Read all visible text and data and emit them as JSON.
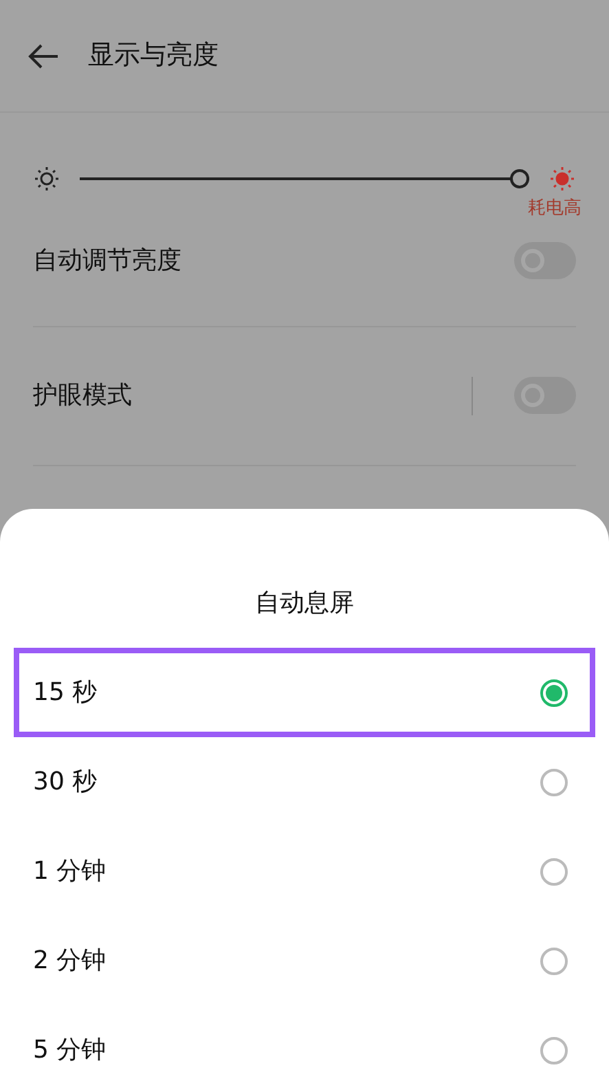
{
  "header": {
    "title": "显示与亮度"
  },
  "brightness": {
    "level": 1,
    "warning": "耗电高"
  },
  "settings": [
    {
      "label": "自动调节亮度",
      "on": false,
      "separator": false
    },
    {
      "label": "护眼模式",
      "on": false,
      "separator": true
    }
  ],
  "sheet": {
    "title": "自动息屏",
    "options": [
      {
        "label": "15 秒",
        "selected": true,
        "highlighted": true
      },
      {
        "label": "30 秒",
        "selected": false,
        "highlighted": false
      },
      {
        "label": "1 分钟",
        "selected": false,
        "highlighted": false
      },
      {
        "label": "2 分钟",
        "selected": false,
        "highlighted": false
      },
      {
        "label": "5 分钟",
        "selected": false,
        "highlighted": false
      }
    ]
  }
}
